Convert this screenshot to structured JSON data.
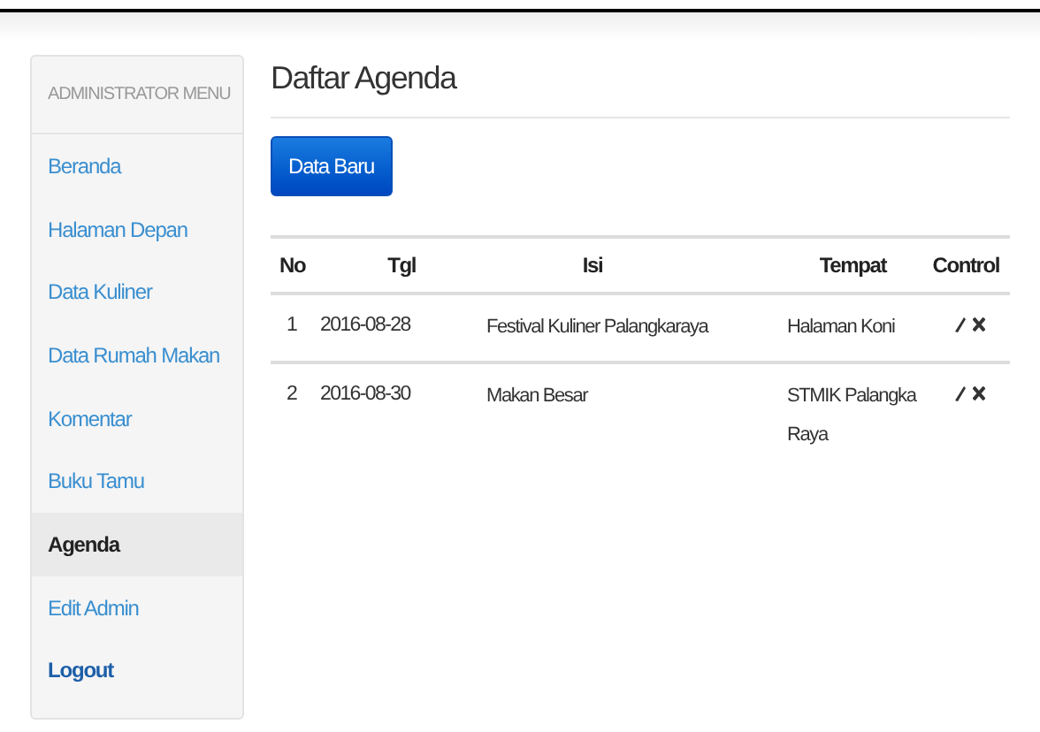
{
  "sidebar": {
    "title": "ADMINISTRATOR MENU",
    "items": [
      {
        "label": "Beranda",
        "selected": false,
        "kind": "link"
      },
      {
        "label": "Halaman Depan",
        "selected": false,
        "kind": "link"
      },
      {
        "label": "Data Kuliner",
        "selected": false,
        "kind": "link"
      },
      {
        "label": "Data Rumah Makan",
        "selected": false,
        "kind": "link"
      },
      {
        "label": "Komentar",
        "selected": false,
        "kind": "link"
      },
      {
        "label": "Buku Tamu",
        "selected": false,
        "kind": "link"
      },
      {
        "label": "Agenda",
        "selected": true,
        "kind": "link"
      },
      {
        "label": "Edit Admin",
        "selected": false,
        "kind": "link"
      },
      {
        "label": "Logout",
        "selected": false,
        "kind": "logout"
      }
    ]
  },
  "page": {
    "title": "Daftar Agenda",
    "new_button": "Data Baru"
  },
  "table": {
    "columns": [
      "No",
      "Tgl",
      "Isi",
      "Tempat",
      "Control"
    ],
    "rows": [
      {
        "no": "1",
        "tgl": "2016-08-28",
        "isi": "Festival Kuliner Palangkaraya",
        "tempat": "Halaman Koni"
      },
      {
        "no": "2",
        "tgl": "2016-08-30",
        "isi": "Makan Besar",
        "tempat": "STMIK Palangka Raya"
      }
    ]
  }
}
